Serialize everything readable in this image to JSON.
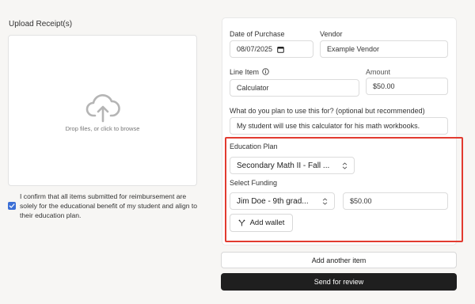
{
  "upload": {
    "label": "Upload Receipt(s)",
    "drop_text": "Drop files, or click to browse"
  },
  "confirm": {
    "checked": true,
    "text": "I confirm that all items submitted for reimbursement are solely for the educational benefit of my student and align to their education plan."
  },
  "form": {
    "date_label": "Date of Purchase",
    "date_value": "08/07/2025",
    "vendor_label": "Vendor",
    "vendor_value": "Example Vendor",
    "line_item_label": "Line Item",
    "line_item_value": "Calculator",
    "amount_label": "Amount",
    "amount_value": "$50.00",
    "purpose_label": "What do you plan to use this for? (optional but recommended)",
    "purpose_value": "My student will use this calculator for his math workbooks.",
    "education_plan_label": "Education Plan",
    "education_plan_value": "Secondary Math II - Fall ...",
    "funding_label": "Select Funding",
    "funding_value": "Jim Doe - 9th grad...",
    "funding_amount": "$50.00",
    "add_wallet_label": "Add wallet"
  },
  "actions": {
    "add_item_label": "Add another item",
    "send_label": "Send for review"
  },
  "colors": {
    "highlight": "#e23b30",
    "checkbox": "#3b6fd6",
    "primary_button": "#1f1f1f"
  }
}
